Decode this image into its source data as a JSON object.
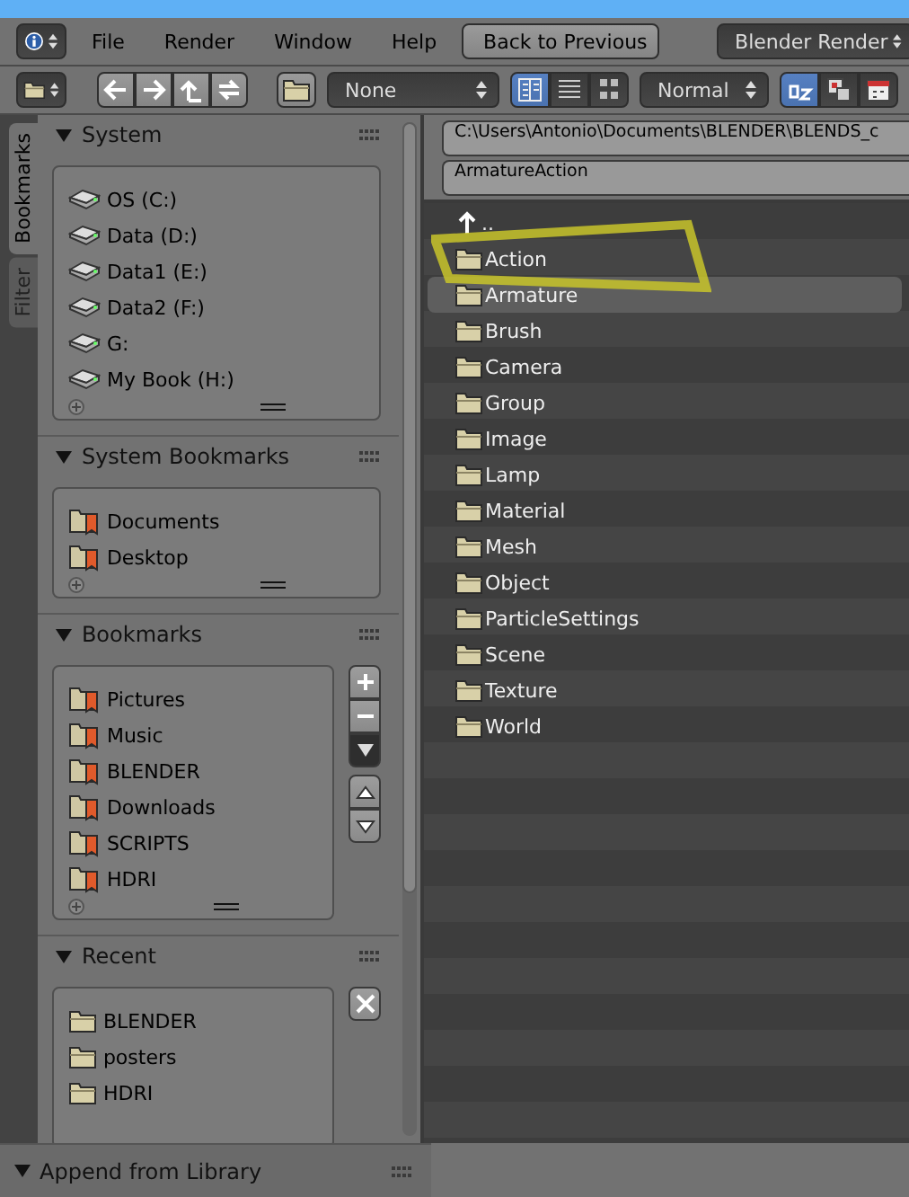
{
  "menubar": {
    "menus": [
      "File",
      "Render",
      "Window",
      "Help"
    ],
    "back_button": "Back to Previous",
    "render_engine": "Blender Render"
  },
  "toolbar": {
    "display_mode": "None",
    "view_buttons": [
      {
        "kind": "short",
        "selected": true
      },
      {
        "kind": "long",
        "selected": false
      },
      {
        "kind": "thumbnails",
        "selected": false
      }
    ],
    "thumbnail_size": "Normal",
    "sort_buttons": [
      {
        "kind": "alpha",
        "selected": true
      },
      {
        "kind": "type",
        "selected": false
      },
      {
        "kind": "date",
        "selected": false
      }
    ]
  },
  "sidebar": {
    "tabs": [
      {
        "label": "Bookmarks",
        "selected": true
      },
      {
        "label": "Filter",
        "selected": false
      }
    ],
    "panels": [
      {
        "title": "System",
        "expanded": true,
        "kind": "plain",
        "footer": true,
        "items": [
          {
            "kind": "drive",
            "label": "OS (C:)"
          },
          {
            "kind": "drive",
            "label": "Data (D:)"
          },
          {
            "kind": "drive",
            "label": "Data1 (E:)"
          },
          {
            "kind": "drive",
            "label": "Data2 (F:)"
          },
          {
            "kind": "drive",
            "label": "G:"
          },
          {
            "kind": "drive",
            "label": "My Book (H:)"
          }
        ]
      },
      {
        "title": "System Bookmarks",
        "expanded": true,
        "kind": "plain",
        "footer": true,
        "items": [
          {
            "kind": "bookmark",
            "label": "Documents"
          },
          {
            "kind": "bookmark",
            "label": "Desktop"
          }
        ]
      },
      {
        "title": "Bookmarks",
        "expanded": true,
        "kind": "editable",
        "footer": true,
        "items": [
          {
            "kind": "bookmark",
            "label": "Pictures"
          },
          {
            "kind": "bookmark",
            "label": "Music"
          },
          {
            "kind": "bookmark",
            "label": "BLENDER"
          },
          {
            "kind": "bookmark",
            "label": "Downloads"
          },
          {
            "kind": "bookmark",
            "label": "SCRIPTS"
          },
          {
            "kind": "bookmark",
            "label": "HDRI"
          }
        ]
      },
      {
        "title": "Recent",
        "expanded": true,
        "kind": "recent",
        "footer": false,
        "items": [
          {
            "kind": "folder",
            "label": "BLENDER"
          },
          {
            "kind": "folder",
            "label": "posters"
          },
          {
            "kind": "folder",
            "label": "HDRI"
          }
        ]
      }
    ],
    "footer_panel": {
      "title": "Append from Library",
      "expanded": true
    }
  },
  "file_browser": {
    "path": "C:\\Users\\Antonio\\Documents\\BLENDER\\BLENDS_c",
    "filename": "ArmatureAction",
    "files": [
      {
        "kind": "parent",
        "name": "..",
        "selected": false
      },
      {
        "kind": "folder",
        "name": "Action",
        "selected": false
      },
      {
        "kind": "folder",
        "name": "Armature",
        "selected": true
      },
      {
        "kind": "folder",
        "name": "Brush",
        "selected": false
      },
      {
        "kind": "folder",
        "name": "Camera",
        "selected": false
      },
      {
        "kind": "folder",
        "name": "Group",
        "selected": false
      },
      {
        "kind": "folder",
        "name": "Image",
        "selected": false
      },
      {
        "kind": "folder",
        "name": "Lamp",
        "selected": false
      },
      {
        "kind": "folder",
        "name": "Material",
        "selected": false
      },
      {
        "kind": "folder",
        "name": "Mesh",
        "selected": false
      },
      {
        "kind": "folder",
        "name": "Object",
        "selected": false
      },
      {
        "kind": "folder",
        "name": "ParticleSettings",
        "selected": false
      },
      {
        "kind": "folder",
        "name": "Scene",
        "selected": false
      },
      {
        "kind": "folder",
        "name": "Texture",
        "selected": false
      },
      {
        "kind": "folder",
        "name": "World",
        "selected": false
      }
    ]
  }
}
